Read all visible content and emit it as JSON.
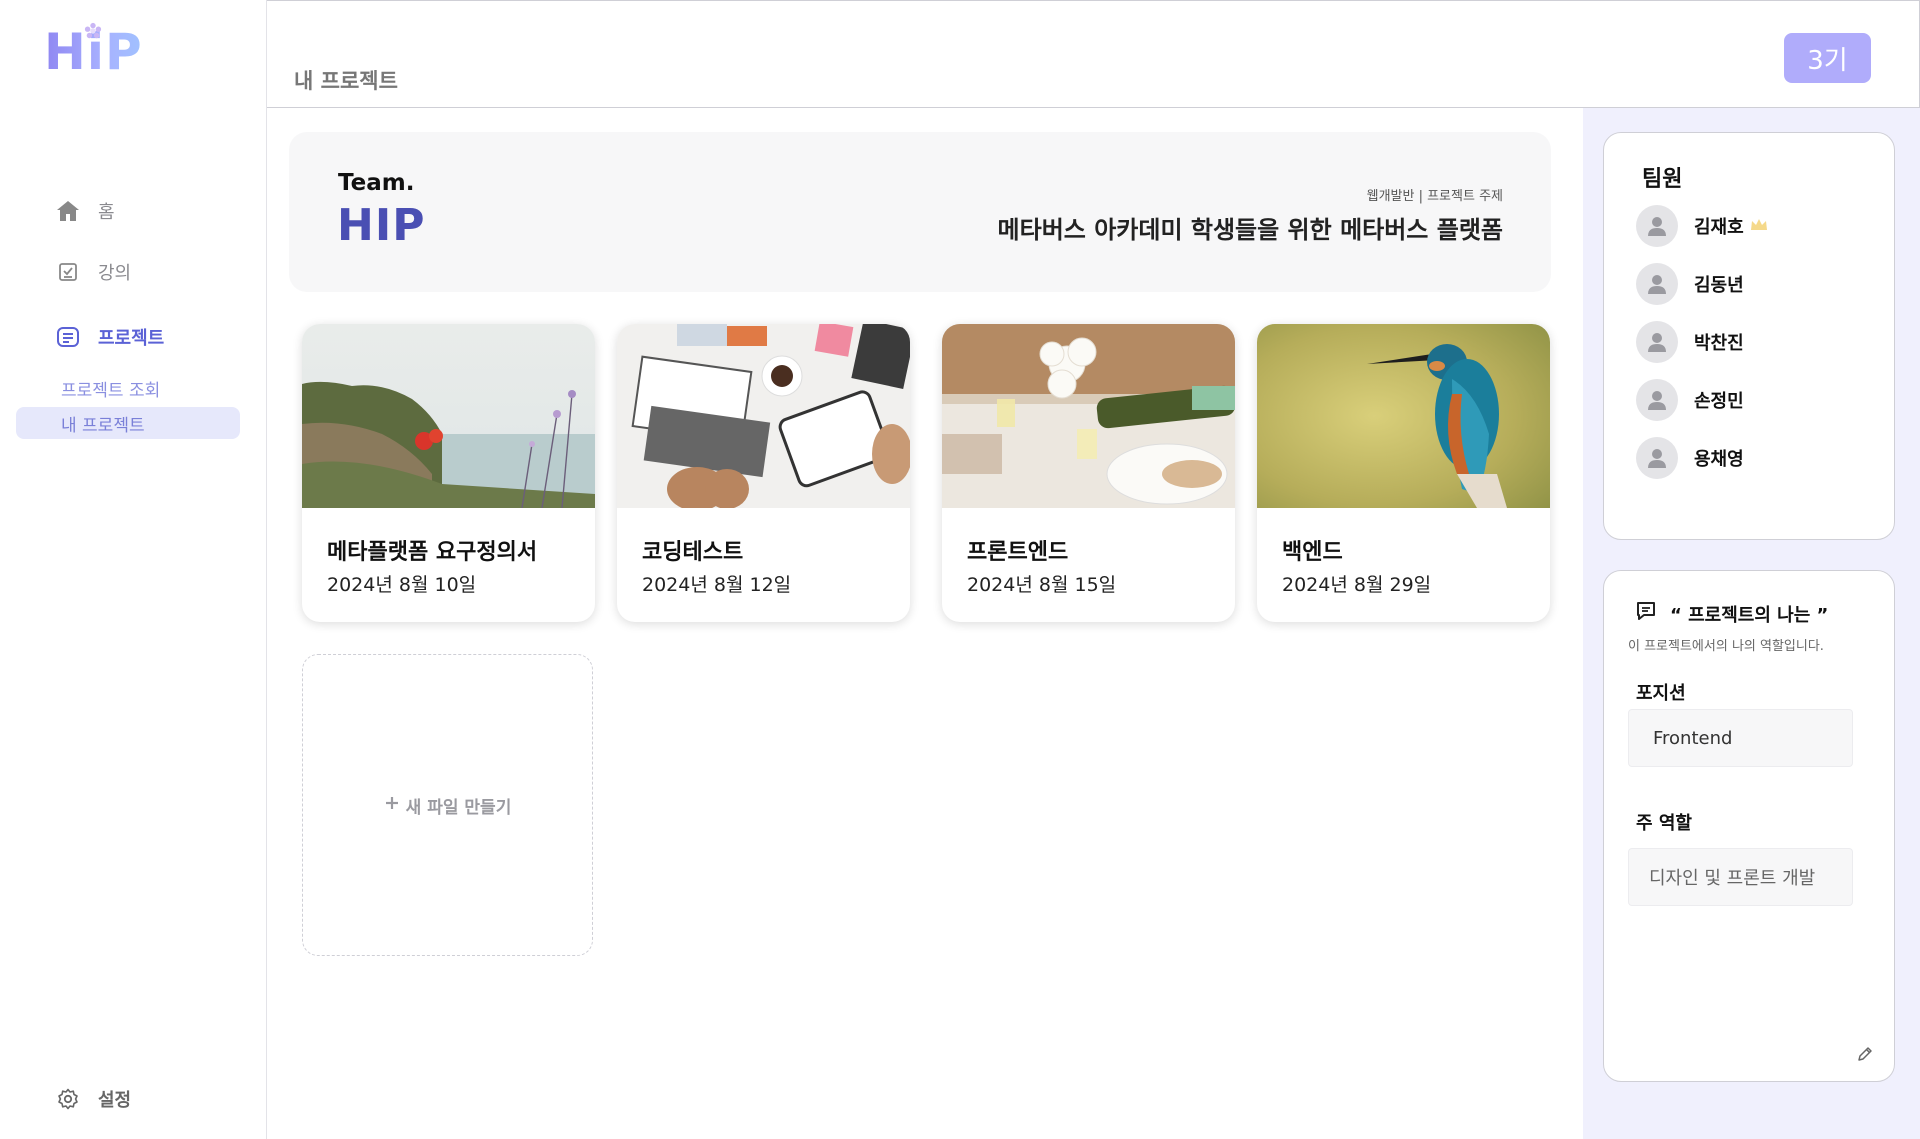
{
  "logo": {
    "text": "HiP"
  },
  "sidebar": {
    "items": [
      {
        "label": "홈",
        "icon": "home-icon"
      },
      {
        "label": "강의",
        "icon": "checklist-icon"
      },
      {
        "label": "프로젝트",
        "icon": "notes-icon"
      }
    ],
    "sub_items": [
      {
        "label": "프로젝트 조회"
      },
      {
        "label": "내 프로젝트"
      }
    ],
    "settings_label": "설정"
  },
  "header": {
    "title": "내 프로젝트",
    "cohort": "3기"
  },
  "team": {
    "prefix": "Team.",
    "name": "HIP",
    "category": "웹개발반 | 프로젝트 주제",
    "topic": "메타버스 아카데미 학생들을 위한 메타버스 플랫폼"
  },
  "cards": [
    {
      "title": "메타플랫폼 요구정의서",
      "date": "2024년 8월 10일"
    },
    {
      "title": "코딩테스트",
      "date": "2024년 8월 12일"
    },
    {
      "title": "프론트엔드",
      "date": "2024년 8월 15일"
    },
    {
      "title": "백엔드",
      "date": "2024년 8월 29일"
    }
  ],
  "new_file_label": "새 파일 만들기",
  "members": {
    "title": "팀원",
    "list": [
      {
        "name": "김재호",
        "leader": true
      },
      {
        "name": "김동년"
      },
      {
        "name": "박찬진"
      },
      {
        "name": "손정민"
      },
      {
        "name": "용채영"
      }
    ]
  },
  "role": {
    "title": "“ 프로젝트의 나는 ”",
    "subtitle": "이 프로젝트에서의 나의 역할입니다.",
    "position_label": "포지션",
    "position_value": "Frontend",
    "main_role_label": "주 역할",
    "main_role_value": "디자인 및 프론트 개발"
  },
  "colors": {
    "accent": "#5b62d6",
    "cohort_badge": "#b0acfb",
    "right_panel_bg": "#f0f0fd",
    "team_name": "#4a4fb3"
  }
}
